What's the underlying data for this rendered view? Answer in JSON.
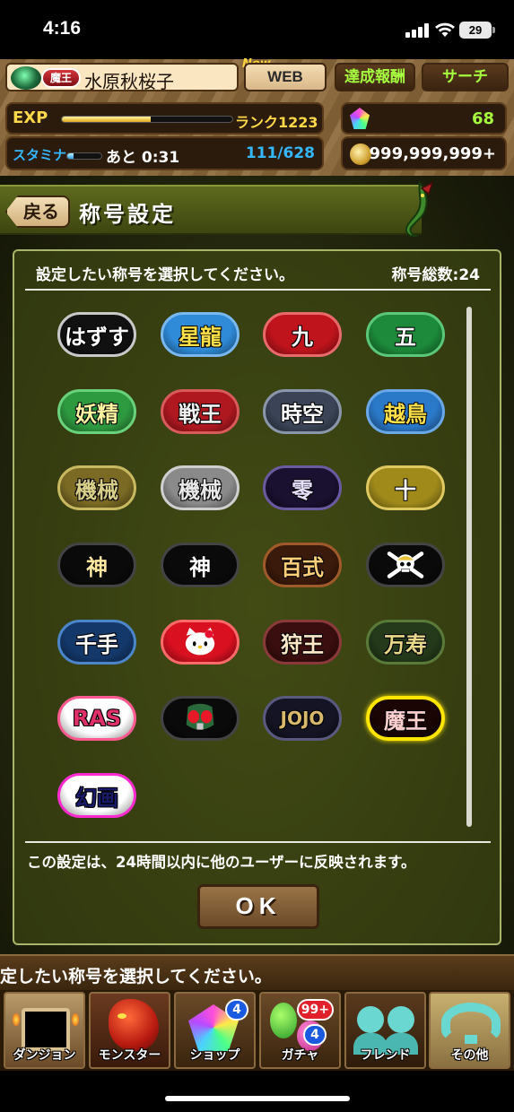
{
  "status_bar": {
    "time": "4:16",
    "battery": "29"
  },
  "header": {
    "rank_badge": "魔王",
    "player_name": "水原秋桜子",
    "new_label": "New",
    "web_button": "WEB",
    "achievements_button": "達成報酬",
    "search_button": "サーチ",
    "exp_label": "EXP",
    "exp_progress": 0.52,
    "rank": "ランク1223",
    "stamina_label": "スタミナ",
    "stamina_progress": 0.18,
    "stamina_recover": "あと 0:31",
    "stamina_value": "111/628",
    "magic_stones": "68",
    "coins": "999,999,999+"
  },
  "title_bar": {
    "back_label": "戻る",
    "title": "称号設定"
  },
  "panel": {
    "instruction": "設定したい称号を選択してください。",
    "total_count": "称号総数:24",
    "notice": "この設定は、24時間以内に他のユーザーに反映されます。",
    "ok_label": "OK"
  },
  "badges": [
    {
      "label": "はずす",
      "bg": "#111111",
      "fg": "#ffffff",
      "border": "#c9c9c9",
      "icon": "none"
    },
    {
      "label": "星龍",
      "bg": "#2f8ad8",
      "fg": "#ffe14a",
      "border": "#7ab8f0",
      "icon": "none"
    },
    {
      "label": "九",
      "bg": "#c0141c",
      "fg": "#ffffff",
      "border": "#e86a6a",
      "icon": "none"
    },
    {
      "label": "五",
      "bg": "#1c8a3a",
      "fg": "#ffffff",
      "border": "#5ac878",
      "icon": "none"
    },
    {
      "label": "妖精",
      "bg": "#2e9a40",
      "fg": "#fff4a0",
      "border": "#6ad27a",
      "icon": "none"
    },
    {
      "label": "戦王",
      "bg": "#b01820",
      "fg": "#f0f0f0",
      "border": "#d85a5a",
      "icon": "none"
    },
    {
      "label": "時空",
      "bg": "#3a4456",
      "fg": "#ffffff",
      "border": "#8a96aa",
      "icon": "none"
    },
    {
      "label": "越鳥",
      "bg": "#2a78c8",
      "fg": "#ffe14a",
      "border": "#6aa8e8",
      "icon": "none"
    },
    {
      "label": "機械",
      "bg": "#7a6a24",
      "fg": "#d8cf8a",
      "border": "#c8b860",
      "icon": "none"
    },
    {
      "label": "機械",
      "bg": "#8a8a8a",
      "fg": "#e8e8e8",
      "border": "#cfcfcf",
      "icon": "none"
    },
    {
      "label": "零",
      "bg": "#1a1030",
      "fg": "#e8e0ff",
      "border": "#6a5aa0",
      "icon": "none"
    },
    {
      "label": "十",
      "bg": "#a08a1a",
      "fg": "#ffffff",
      "border": "#e0c860",
      "icon": "none"
    },
    {
      "label": "神",
      "bg": "#0a0a0a",
      "fg": "#ffe8a0",
      "border": "#444444",
      "icon": "none"
    },
    {
      "label": "神",
      "bg": "#0a0a0a",
      "fg": "#ffffff",
      "border": "#444444",
      "icon": "none"
    },
    {
      "label": "百式",
      "bg": "#3a1a0a",
      "fg": "#ffcf7a",
      "border": "#a05a2a",
      "icon": "none"
    },
    {
      "label": "",
      "bg": "#0a0a0a",
      "fg": "#ffffff",
      "border": "#444444",
      "icon": "skull-crossbones"
    },
    {
      "label": "千手",
      "bg": "#14386a",
      "fg": "#ffffff",
      "border": "#4a86c8",
      "icon": "none"
    },
    {
      "label": "",
      "bg": "#d81020",
      "fg": "#ffffff",
      "border": "#ff6a6a",
      "icon": "hello-kitty"
    },
    {
      "label": "狩王",
      "bg": "#3a0e0e",
      "fg": "#ffe8c8",
      "border": "#8a3a3a",
      "icon": "none"
    },
    {
      "label": "万寿",
      "bg": "#243a1a",
      "fg": "#e8d88a",
      "border": "#5a7a3a",
      "icon": "none"
    },
    {
      "label": "RAS",
      "bg": "#ffffff",
      "fg": "#e0306a",
      "border": "#ff5a90",
      "icon": "none"
    },
    {
      "label": "",
      "bg": "#0a0a0a",
      "fg": "#ffffff",
      "border": "#444444",
      "icon": "kamen-rider-mask"
    },
    {
      "label": "JOJO",
      "bg": "#141424",
      "fg": "#d8b86a",
      "border": "#5a5a80",
      "icon": "none"
    },
    {
      "label": "魔王",
      "bg": "#1a0404",
      "fg": "#ffd0d0",
      "border": "#ffe600",
      "icon": "none"
    },
    {
      "label": "幻画",
      "bg": "#ffffff",
      "fg": "#1a1a6a",
      "border": "#ff2ad0",
      "icon": "none"
    }
  ],
  "ticker": {
    "text": "定したい称号を選択してください。"
  },
  "nav": [
    {
      "label": "ダンジョン",
      "badge": ""
    },
    {
      "label": "モンスター",
      "badge": ""
    },
    {
      "label": "ショップ",
      "badge": "4"
    },
    {
      "label": "ガチャ",
      "badge": "99+",
      "badge2": "4"
    },
    {
      "label": "フレンド",
      "badge": ""
    },
    {
      "label": "その他",
      "badge": ""
    }
  ]
}
